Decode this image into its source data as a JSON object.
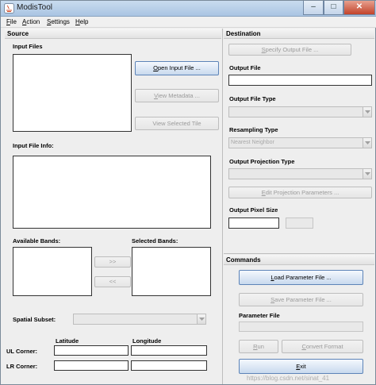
{
  "window": {
    "title": "ModisTool",
    "minimize": "–",
    "maximize": "□",
    "close": "✕"
  },
  "menu": [
    {
      "label": "File",
      "mnemonic": "F",
      "rest": "ile"
    },
    {
      "label": "Action",
      "mnemonic": "A",
      "rest": "ction"
    },
    {
      "label": "Settings",
      "mnemonic": "S",
      "rest": "ettings"
    },
    {
      "label": "Help",
      "mnemonic": "H",
      "rest": "elp"
    }
  ],
  "source": {
    "header": "Source",
    "input_files_label": "Input Files",
    "open_input_file": {
      "m": "O",
      "rest": "pen Input File ..."
    },
    "view_metadata": {
      "m": "V",
      "rest": "iew Metadata ..."
    },
    "view_selected_tile": "View Selected Tile",
    "input_file_info_label": "Input File Info:",
    "available_bands_label": "Available Bands:",
    "selected_bands_label": "Selected Bands:",
    "add_band": ">>",
    "remove_band": "<<",
    "spatial_subset_label": "Spatial Subset:",
    "latitude_label": "Latitude",
    "longitude_label": "Longitude",
    "ul_corner_label": "UL Corner:",
    "lr_corner_label": "LR Corner:"
  },
  "destination": {
    "header": "Destination",
    "specify_output_file": {
      "m": "S",
      "rest": "pecify Output File ..."
    },
    "output_file_label": "Output File",
    "output_file_type_label": "Output File Type",
    "resampling_type_label": "Resampling Type",
    "resampling_value": "Nearest Neighbor",
    "output_projection_type_label": "Output Projection Type",
    "edit_projection_parameters": {
      "m": "E",
      "rest": "dit Projection Parameters ..."
    },
    "output_pixel_size_label": "Output Pixel Size"
  },
  "commands": {
    "header": "Commands",
    "load_parameter_file": {
      "m": "L",
      "rest": "oad Parameter File ..."
    },
    "save_parameter_file": {
      "m": "S",
      "rest": "ave Parameter File ..."
    },
    "parameter_file_label": "Parameter File",
    "run": {
      "m": "R",
      "rest": "un"
    },
    "convert_format": {
      "m": "C",
      "rest": "onvert Format"
    },
    "exit": {
      "m": "E",
      "rest": "xit"
    }
  },
  "watermark": "https://blog.csdn.net/sinat_41"
}
